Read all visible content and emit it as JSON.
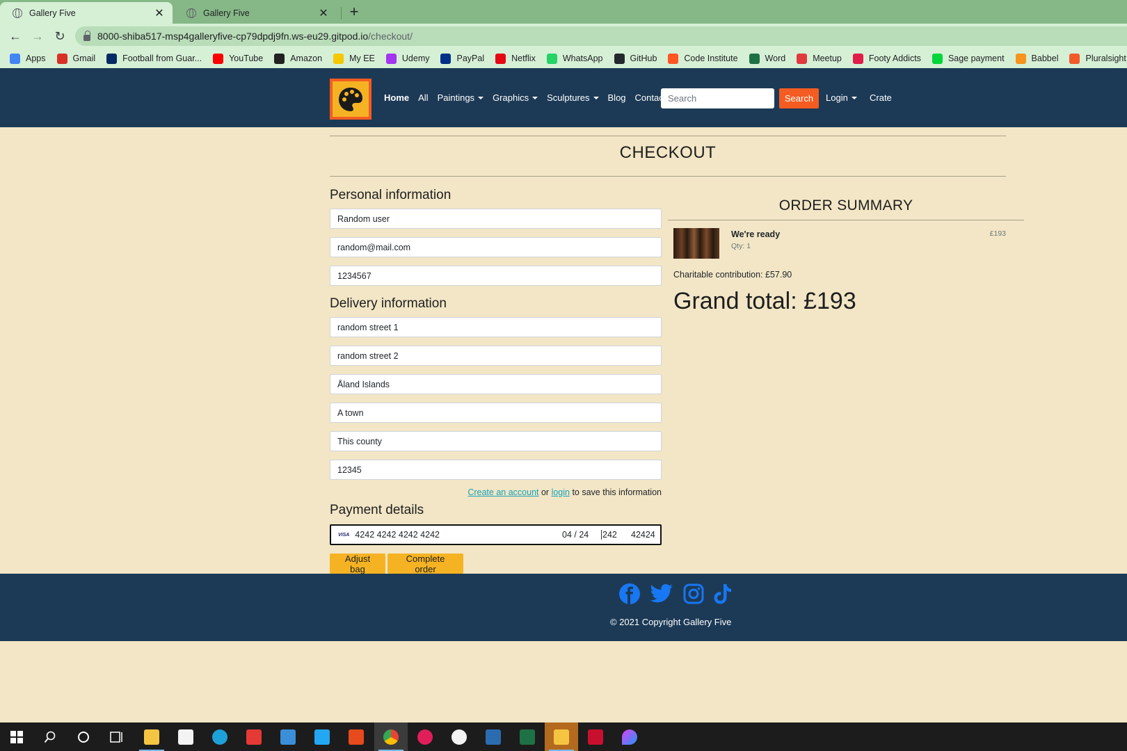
{
  "browser": {
    "tabs": [
      {
        "title": "Gallery Five",
        "active": true
      },
      {
        "title": "Gallery Five",
        "active": false
      }
    ],
    "url_host": "8000-shiba517-msp4galleryfive-cp79dpdj9fn.ws-eu29.gitpod.io",
    "url_path": "/checkout/",
    "bookmarks": [
      {
        "label": "Apps",
        "color": "#4285f4"
      },
      {
        "label": "Gmail",
        "color": "#d93025"
      },
      {
        "label": "Football from Guar...",
        "color": "#052962"
      },
      {
        "label": "YouTube",
        "color": "#ff0000"
      },
      {
        "label": "Amazon",
        "color": "#222222"
      },
      {
        "label": "My EE",
        "color": "#f5c800"
      },
      {
        "label": "Udemy",
        "color": "#a435f0"
      },
      {
        "label": "PayPal",
        "color": "#003087"
      },
      {
        "label": "Netflix",
        "color": "#e50914"
      },
      {
        "label": "WhatsApp",
        "color": "#25d366"
      },
      {
        "label": "GitHub",
        "color": "#24292e"
      },
      {
        "label": "Code Institute",
        "color": "#ff5722"
      },
      {
        "label": "Word",
        "color": "#1e7145"
      },
      {
        "label": "Meetup",
        "color": "#e0393e"
      },
      {
        "label": "Footy Addicts",
        "color": "#e11d48"
      },
      {
        "label": "Sage payment",
        "color": "#00d639"
      },
      {
        "label": "Babbel",
        "color": "#f7931e"
      },
      {
        "label": "Pluralsight",
        "color": "#f15b2a"
      }
    ]
  },
  "nav": {
    "links": [
      "Home",
      "All",
      "Paintings",
      "Graphics",
      "Sculptures",
      "Blog",
      "Contact"
    ],
    "search_placeholder": "Search",
    "search_button": "Search",
    "login": "Login",
    "crate": "Crate"
  },
  "checkout": {
    "title": "CHECKOUT",
    "personal_heading": "Personal information",
    "full_name": "Random user",
    "email": "random@mail.com",
    "phone": "1234567",
    "delivery_heading": "Delivery information",
    "street1": "random street 1",
    "street2": "random street 2",
    "country": "Åland Islands",
    "town": "A town",
    "county": "This county",
    "postcode": "12345",
    "save_create": "Create an account",
    "save_or": " or ",
    "save_login": "login",
    "save_rest": " to save this information",
    "payment_heading": "Payment details",
    "card_brand": "VISA",
    "card_number": "4242 4242 4242 4242",
    "card_expiry": "04 / 24",
    "card_cvc": "242",
    "card_zip": "42424",
    "adjust_bag": "Adjust bag",
    "complete_order": "Complete order"
  },
  "summary": {
    "title": "ORDER SUMMARY",
    "item_name": "We're ready",
    "item_qty": "Qty: 1",
    "item_price": "£193",
    "charity": "Charitable contribution: £57.90",
    "grand_total": "Grand total: £193"
  },
  "footer": {
    "social": [
      "facebook-icon",
      "twitter-icon",
      "instagram-icon",
      "tiktok-icon"
    ],
    "social_color": "#1877f2",
    "copyright": "© 2021 Copyright Gallery Five"
  },
  "colors": {
    "nav_bg": "#1c3a56",
    "page_bg": "#f2e6c6",
    "accent_orange": "#f45c22",
    "accent_yellow": "#f5b324",
    "tab_bar": "#86b887"
  }
}
